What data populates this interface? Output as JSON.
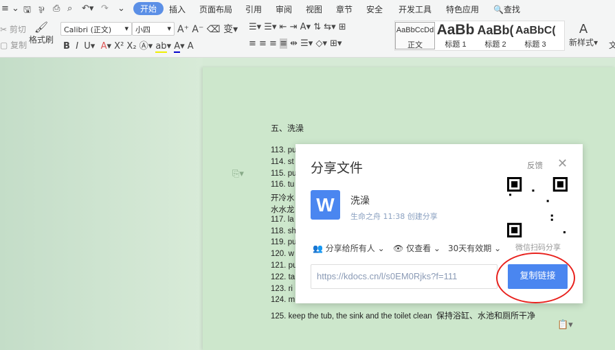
{
  "menubar": {
    "tabs": [
      "开始",
      "插入",
      "页面布局",
      "引用",
      "审阅",
      "视图",
      "章节",
      "安全",
      "开发工具",
      "特色应用"
    ],
    "active_tab": "开始",
    "search": "查找"
  },
  "ribbon": {
    "cut": "剪切",
    "copy": "复制",
    "format_painter": "格式刷",
    "font_name": "Calibri (正文)",
    "font_size": "小四",
    "styles": [
      {
        "preview": "AaBbCcDd",
        "label": "正文"
      },
      {
        "preview": "AaBb",
        "label": "标题 1"
      },
      {
        "preview": "AaBb(",
        "label": "标题 2"
      },
      {
        "preview": "AaBbC(",
        "label": "标题 3"
      }
    ],
    "new_style": "新样式",
    "more": "文"
  },
  "document": {
    "heading": "五、洗澡",
    "lines": [
      "113. pu",
      "114. st",
      "115. pu",
      "116. tu",
      "开冷水",
      "水水龙",
      "117. la",
      "118. sh",
      "119. pu",
      "120. w",
      "121. pu",
      "122. ta",
      "123. ri",
      "124. m"
    ],
    "last_line_en": "125. keep the tub, the sink and the toilet clean",
    "last_line_cn": "保持浴缸、水池和厕所干净"
  },
  "dialog": {
    "title": "分享文件",
    "feedback": "反馈",
    "file_name": "洗澡",
    "file_meta": "生命之舟 11:38 创建分享",
    "qr_caption": "微信扫码分享",
    "share_scope": "分享给所有人",
    "permission": "仅查看",
    "validity": "30天有效期",
    "link": "https://kdocs.cn/l/s0EM0Rjks?f=111",
    "copy_button": "复制链接"
  },
  "colors": {
    "accent": "#4a86f0",
    "annotation": "#e8211d",
    "page": "#cde7cc"
  }
}
